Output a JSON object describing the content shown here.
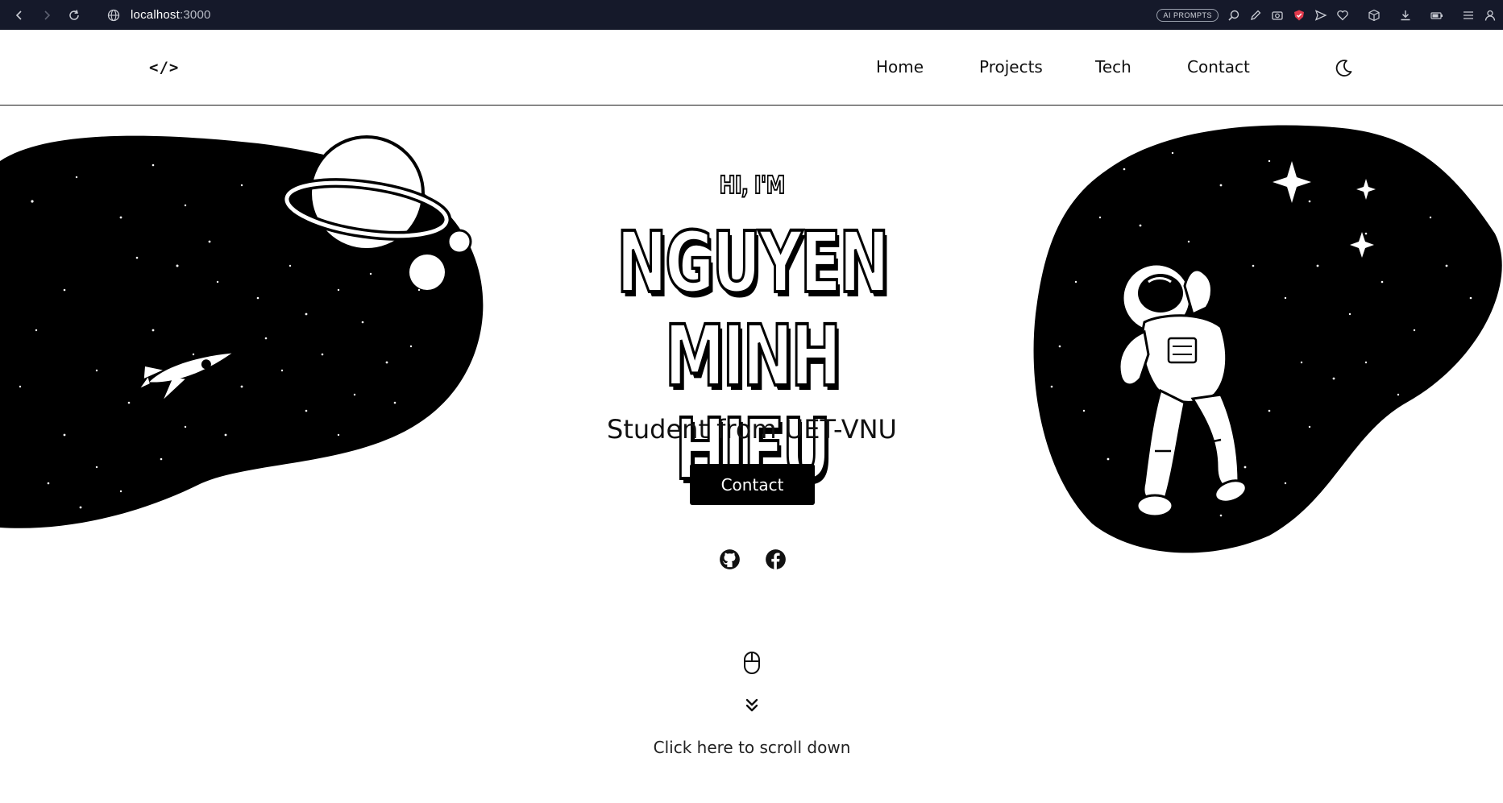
{
  "browser": {
    "url_host": "localhost",
    "url_port": ":3000",
    "ai_badge": "AI PROMPTS"
  },
  "header": {
    "logo": "</>",
    "nav": [
      {
        "label": "Home"
      },
      {
        "label": "Projects"
      },
      {
        "label": "Tech"
      },
      {
        "label": "Contact"
      }
    ]
  },
  "hero": {
    "greeting": "HI, I'M",
    "name_line1": "NGUYEN MINH",
    "name_line2": "HIEU",
    "subtitle": "Student from UET-VNU",
    "contact_label": "Contact",
    "scroll_hint": "Click here to scroll down"
  },
  "colors": {
    "chrome_bg": "#15192a",
    "primary": "#000000",
    "background": "#ffffff"
  },
  "icons": {
    "socials": [
      "github-icon",
      "facebook-icon"
    ],
    "theme": "moon-icon",
    "scroll": [
      "mouse-icon",
      "chevrons-down-icon"
    ]
  }
}
